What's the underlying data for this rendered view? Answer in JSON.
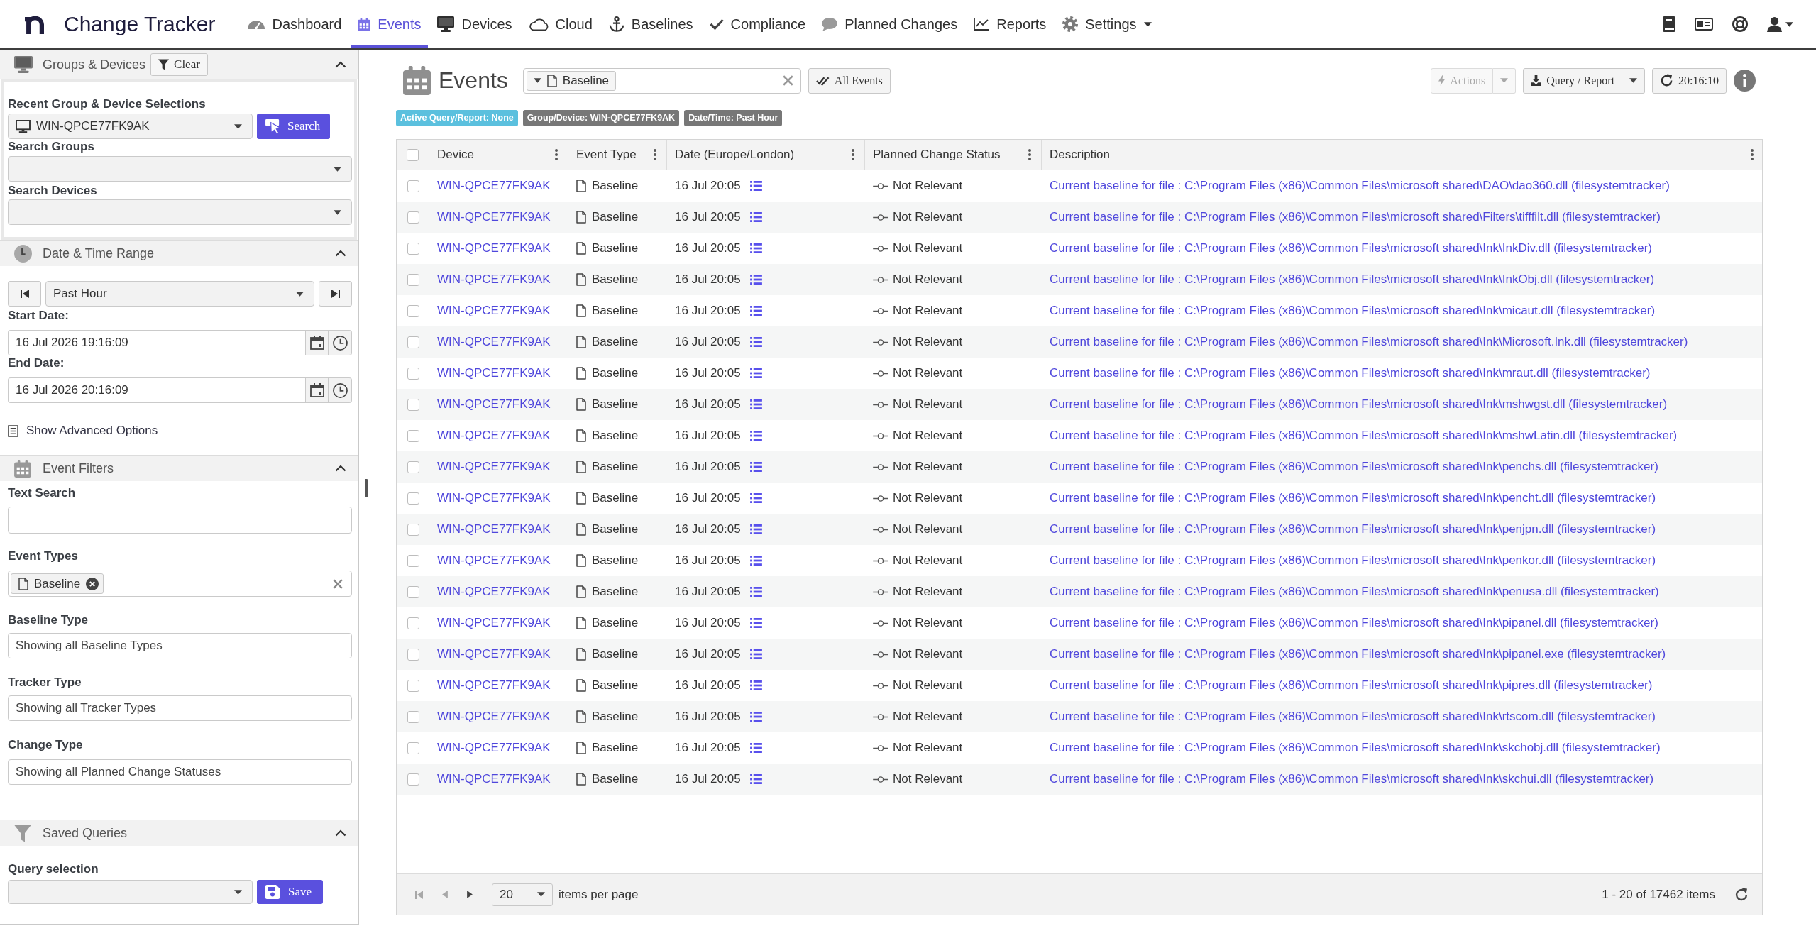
{
  "app": {
    "title": "Change Tracker"
  },
  "nav": [
    {
      "label": "Dashboard",
      "selected": false,
      "dropdown": false
    },
    {
      "label": "Events",
      "selected": true,
      "dropdown": false
    },
    {
      "label": "Devices",
      "selected": false,
      "dropdown": false
    },
    {
      "label": "Cloud",
      "selected": false,
      "dropdown": false
    },
    {
      "label": "Baselines",
      "selected": false,
      "dropdown": false
    },
    {
      "label": "Compliance",
      "selected": false,
      "dropdown": false
    },
    {
      "label": "Planned Changes",
      "selected": false,
      "dropdown": false
    },
    {
      "label": "Reports",
      "selected": false,
      "dropdown": false
    },
    {
      "label": "Settings",
      "selected": false,
      "dropdown": true
    }
  ],
  "sidebar": {
    "groups_devices": {
      "title": "Groups & Devices",
      "expanded": true,
      "clear_button": "Clear",
      "recent_label": "Recent Group & Device Selections",
      "recent_value": "WIN-QPCE77FK9AK",
      "search_button": "Search",
      "groups_label": "Search Groups",
      "devices_label": "Search Devices"
    },
    "date_time": {
      "title": "Date & Time Range",
      "expanded": true,
      "range": "Past Hour",
      "start_label": "Start Date:",
      "start_value": "16 Jul 2026 19:16:09",
      "end_label": "End Date:",
      "end_value": "16 Jul 2026 20:16:09",
      "advanced_link": "Show Advanced Options"
    },
    "event_filters": {
      "title": "Event Filters",
      "expanded": true,
      "text_search_label": "Text Search",
      "event_types_label": "Event Types",
      "event_types": [
        "Baseline"
      ],
      "selects": [
        {
          "label": "Baseline Type",
          "placeholder": "Showing all Baseline Types"
        },
        {
          "label": "Tracker Type",
          "placeholder": "Showing all Tracker Types"
        },
        {
          "label": "Change Type",
          "placeholder": "Showing all Planned Change Statuses"
        }
      ]
    },
    "saved_queries": {
      "title": "Saved Queries",
      "expanded": true,
      "query_label": "Query selection",
      "save_button": "Save"
    }
  },
  "page": {
    "title": "Events",
    "filter_chip": "Baseline",
    "all_events_button": "All Events",
    "actions_button": {
      "label": "Actions",
      "disabled": true
    },
    "query_report_button": "Query / Report",
    "refresh_button": "20:16:10"
  },
  "badges": [
    {
      "text": "Active Query/Report: None",
      "color": "#5bc0de"
    },
    {
      "text": "Group/Device: WIN-QPCE77FK9AK",
      "color": "#777777"
    },
    {
      "text": "Date/Time: Past Hour",
      "color": "#777777"
    }
  ],
  "table": {
    "all_selected": false,
    "columns": [
      {
        "label": "Device"
      },
      {
        "label": "Event Type"
      },
      {
        "label": "Date (Europe/London)"
      },
      {
        "label": "Planned Change Status"
      },
      {
        "label": "Description"
      }
    ],
    "rows": [
      {
        "selected": false,
        "device": "WIN-QPCE77FK9AK",
        "event_type": "Baseline",
        "date": "16 Jul 20:05",
        "status": "Not Relevant",
        "description": "Current baseline for file : C:\\Program Files (x86)\\Common Files\\microsoft shared\\DAO\\dao360.dll (filesystemtracker)"
      },
      {
        "selected": false,
        "device": "WIN-QPCE77FK9AK",
        "event_type": "Baseline",
        "date": "16 Jul 20:05",
        "status": "Not Relevant",
        "description": "Current baseline for file : C:\\Program Files (x86)\\Common Files\\microsoft shared\\Filters\\tifffilt.dll (filesystemtracker)"
      },
      {
        "selected": false,
        "device": "WIN-QPCE77FK9AK",
        "event_type": "Baseline",
        "date": "16 Jul 20:05",
        "status": "Not Relevant",
        "description": "Current baseline for file : C:\\Program Files (x86)\\Common Files\\microsoft shared\\Ink\\InkDiv.dll (filesystemtracker)"
      },
      {
        "selected": false,
        "device": "WIN-QPCE77FK9AK",
        "event_type": "Baseline",
        "date": "16 Jul 20:05",
        "status": "Not Relevant",
        "description": "Current baseline for file : C:\\Program Files (x86)\\Common Files\\microsoft shared\\Ink\\InkObj.dll (filesystemtracker)"
      },
      {
        "selected": false,
        "device": "WIN-QPCE77FK9AK",
        "event_type": "Baseline",
        "date": "16 Jul 20:05",
        "status": "Not Relevant",
        "description": "Current baseline for file : C:\\Program Files (x86)\\Common Files\\microsoft shared\\Ink\\micaut.dll (filesystemtracker)"
      },
      {
        "selected": false,
        "device": "WIN-QPCE77FK9AK",
        "event_type": "Baseline",
        "date": "16 Jul 20:05",
        "status": "Not Relevant",
        "description": "Current baseline for file : C:\\Program Files (x86)\\Common Files\\microsoft shared\\Ink\\Microsoft.Ink.dll (filesystemtracker)"
      },
      {
        "selected": false,
        "device": "WIN-QPCE77FK9AK",
        "event_type": "Baseline",
        "date": "16 Jul 20:05",
        "status": "Not Relevant",
        "description": "Current baseline for file : C:\\Program Files (x86)\\Common Files\\microsoft shared\\Ink\\mraut.dll (filesystemtracker)"
      },
      {
        "selected": false,
        "device": "WIN-QPCE77FK9AK",
        "event_type": "Baseline",
        "date": "16 Jul 20:05",
        "status": "Not Relevant",
        "description": "Current baseline for file : C:\\Program Files (x86)\\Common Files\\microsoft shared\\Ink\\mshwgst.dll (filesystemtracker)"
      },
      {
        "selected": false,
        "device": "WIN-QPCE77FK9AK",
        "event_type": "Baseline",
        "date": "16 Jul 20:05",
        "status": "Not Relevant",
        "description": "Current baseline for file : C:\\Program Files (x86)\\Common Files\\microsoft shared\\Ink\\mshwLatin.dll (filesystemtracker)"
      },
      {
        "selected": false,
        "device": "WIN-QPCE77FK9AK",
        "event_type": "Baseline",
        "date": "16 Jul 20:05",
        "status": "Not Relevant",
        "description": "Current baseline for file : C:\\Program Files (x86)\\Common Files\\microsoft shared\\Ink\\penchs.dll (filesystemtracker)"
      },
      {
        "selected": false,
        "device": "WIN-QPCE77FK9AK",
        "event_type": "Baseline",
        "date": "16 Jul 20:05",
        "status": "Not Relevant",
        "description": "Current baseline for file : C:\\Program Files (x86)\\Common Files\\microsoft shared\\Ink\\pencht.dll (filesystemtracker)"
      },
      {
        "selected": false,
        "device": "WIN-QPCE77FK9AK",
        "event_type": "Baseline",
        "date": "16 Jul 20:05",
        "status": "Not Relevant",
        "description": "Current baseline for file : C:\\Program Files (x86)\\Common Files\\microsoft shared\\Ink\\penjpn.dll (filesystemtracker)"
      },
      {
        "selected": false,
        "device": "WIN-QPCE77FK9AK",
        "event_type": "Baseline",
        "date": "16 Jul 20:05",
        "status": "Not Relevant",
        "description": "Current baseline for file : C:\\Program Files (x86)\\Common Files\\microsoft shared\\Ink\\penkor.dll (filesystemtracker)"
      },
      {
        "selected": false,
        "device": "WIN-QPCE77FK9AK",
        "event_type": "Baseline",
        "date": "16 Jul 20:05",
        "status": "Not Relevant",
        "description": "Current baseline for file : C:\\Program Files (x86)\\Common Files\\microsoft shared\\Ink\\penusa.dll (filesystemtracker)"
      },
      {
        "selected": false,
        "device": "WIN-QPCE77FK9AK",
        "event_type": "Baseline",
        "date": "16 Jul 20:05",
        "status": "Not Relevant",
        "description": "Current baseline for file : C:\\Program Files (x86)\\Common Files\\microsoft shared\\Ink\\pipanel.dll (filesystemtracker)"
      },
      {
        "selected": false,
        "device": "WIN-QPCE77FK9AK",
        "event_type": "Baseline",
        "date": "16 Jul 20:05",
        "status": "Not Relevant",
        "description": "Current baseline for file : C:\\Program Files (x86)\\Common Files\\microsoft shared\\Ink\\pipanel.exe (filesystemtracker)"
      },
      {
        "selected": false,
        "device": "WIN-QPCE77FK9AK",
        "event_type": "Baseline",
        "date": "16 Jul 20:05",
        "status": "Not Relevant",
        "description": "Current baseline for file : C:\\Program Files (x86)\\Common Files\\microsoft shared\\Ink\\pipres.dll (filesystemtracker)"
      },
      {
        "selected": false,
        "device": "WIN-QPCE77FK9AK",
        "event_type": "Baseline",
        "date": "16 Jul 20:05",
        "status": "Not Relevant",
        "description": "Current baseline for file : C:\\Program Files (x86)\\Common Files\\microsoft shared\\Ink\\rtscom.dll (filesystemtracker)"
      },
      {
        "selected": false,
        "device": "WIN-QPCE77FK9AK",
        "event_type": "Baseline",
        "date": "16 Jul 20:05",
        "status": "Not Relevant",
        "description": "Current baseline for file : C:\\Program Files (x86)\\Common Files\\microsoft shared\\Ink\\skchobj.dll (filesystemtracker)"
      },
      {
        "selected": false,
        "device": "WIN-QPCE77FK9AK",
        "event_type": "Baseline",
        "date": "16 Jul 20:05",
        "status": "Not Relevant",
        "description": "Current baseline for file : C:\\Program Files (x86)\\Common Files\\microsoft shared\\Ink\\skchui.dll (filesystemtracker)"
      }
    ]
  },
  "pager": {
    "buttons": [
      {
        "kind": "first",
        "disabled": true
      },
      {
        "kind": "previous",
        "disabled": true
      },
      {
        "kind": "next",
        "disabled": false
      }
    ],
    "page_size": "20",
    "page_size_label": "items per page",
    "summary": "1 - 20 of 17462 items"
  }
}
